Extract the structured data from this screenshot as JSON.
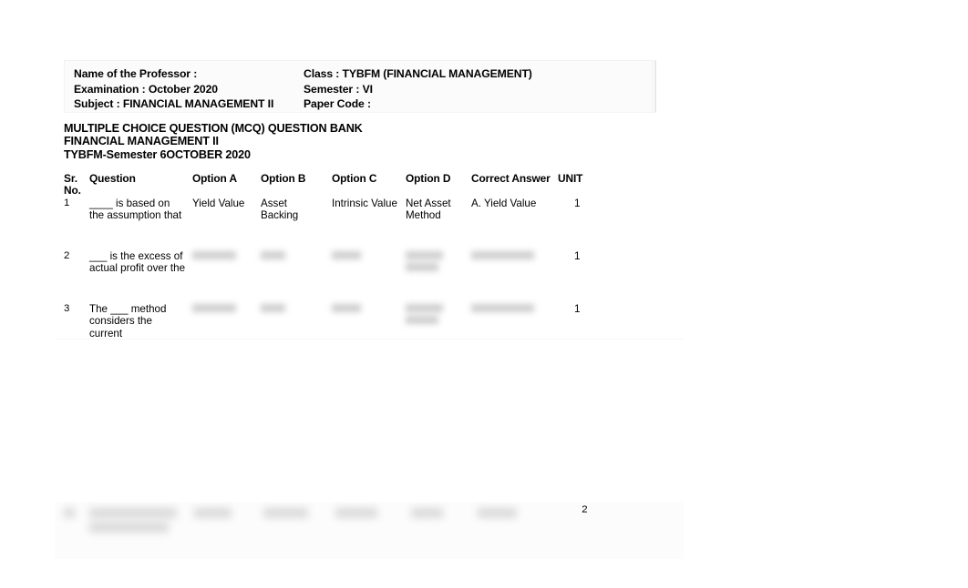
{
  "document": {
    "meta_header": {
      "rows": [
        {
          "left": "Name of the Professor :",
          "right": "Class : TYBFM (FINANCIAL MANAGEMENT)"
        },
        {
          "left": "Examination : October 2020",
          "right": "Semester : VI"
        },
        {
          "left": "Subject : FINANCIAL MANAGEMENT II",
          "right": "Paper Code :"
        }
      ]
    },
    "title_block": {
      "lines": [
        "MULTIPLE CHOICE QUESTION (MCQ) QUESTION BANK",
        "FINANCIAL MANAGEMENT II",
        "TYBFM-Semester 6OCTOBER 2020"
      ]
    },
    "table": {
      "headers": [
        "Sr. No.",
        "Question",
        "Option A",
        "Option B",
        "Option C",
        "Option D",
        "Correct Answer",
        "UNIT"
      ],
      "rows": [
        {
          "sr_no": "1",
          "question": "____ is based on the assumption that",
          "option_a": "Yield Value",
          "option_b": "Asset Backing",
          "option_c": "Intrinsic Value",
          "option_d": "Net Asset Method",
          "correct_answer": "A. Yield Value",
          "unit": "1",
          "rendered": true
        },
        {
          "sr_no": "2",
          "question": "___ is the excess of actual profit over the",
          "option_a": "",
          "option_b": "",
          "option_c": "",
          "option_d": "",
          "correct_answer": "",
          "unit": "1",
          "rendered": false
        },
        {
          "sr_no": "3",
          "question": "The ___ method considers the current",
          "option_a": "",
          "option_b": "",
          "option_c": "",
          "option_d": "",
          "correct_answer": "",
          "unit": "1",
          "rendered": false
        }
      ],
      "partial_bottom_row": {
        "sr_no": "",
        "question": "",
        "option_a": "",
        "option_b": "",
        "option_c": "",
        "option_d": "",
        "correct_answer": "",
        "unit": "2",
        "rendered": false
      }
    }
  }
}
